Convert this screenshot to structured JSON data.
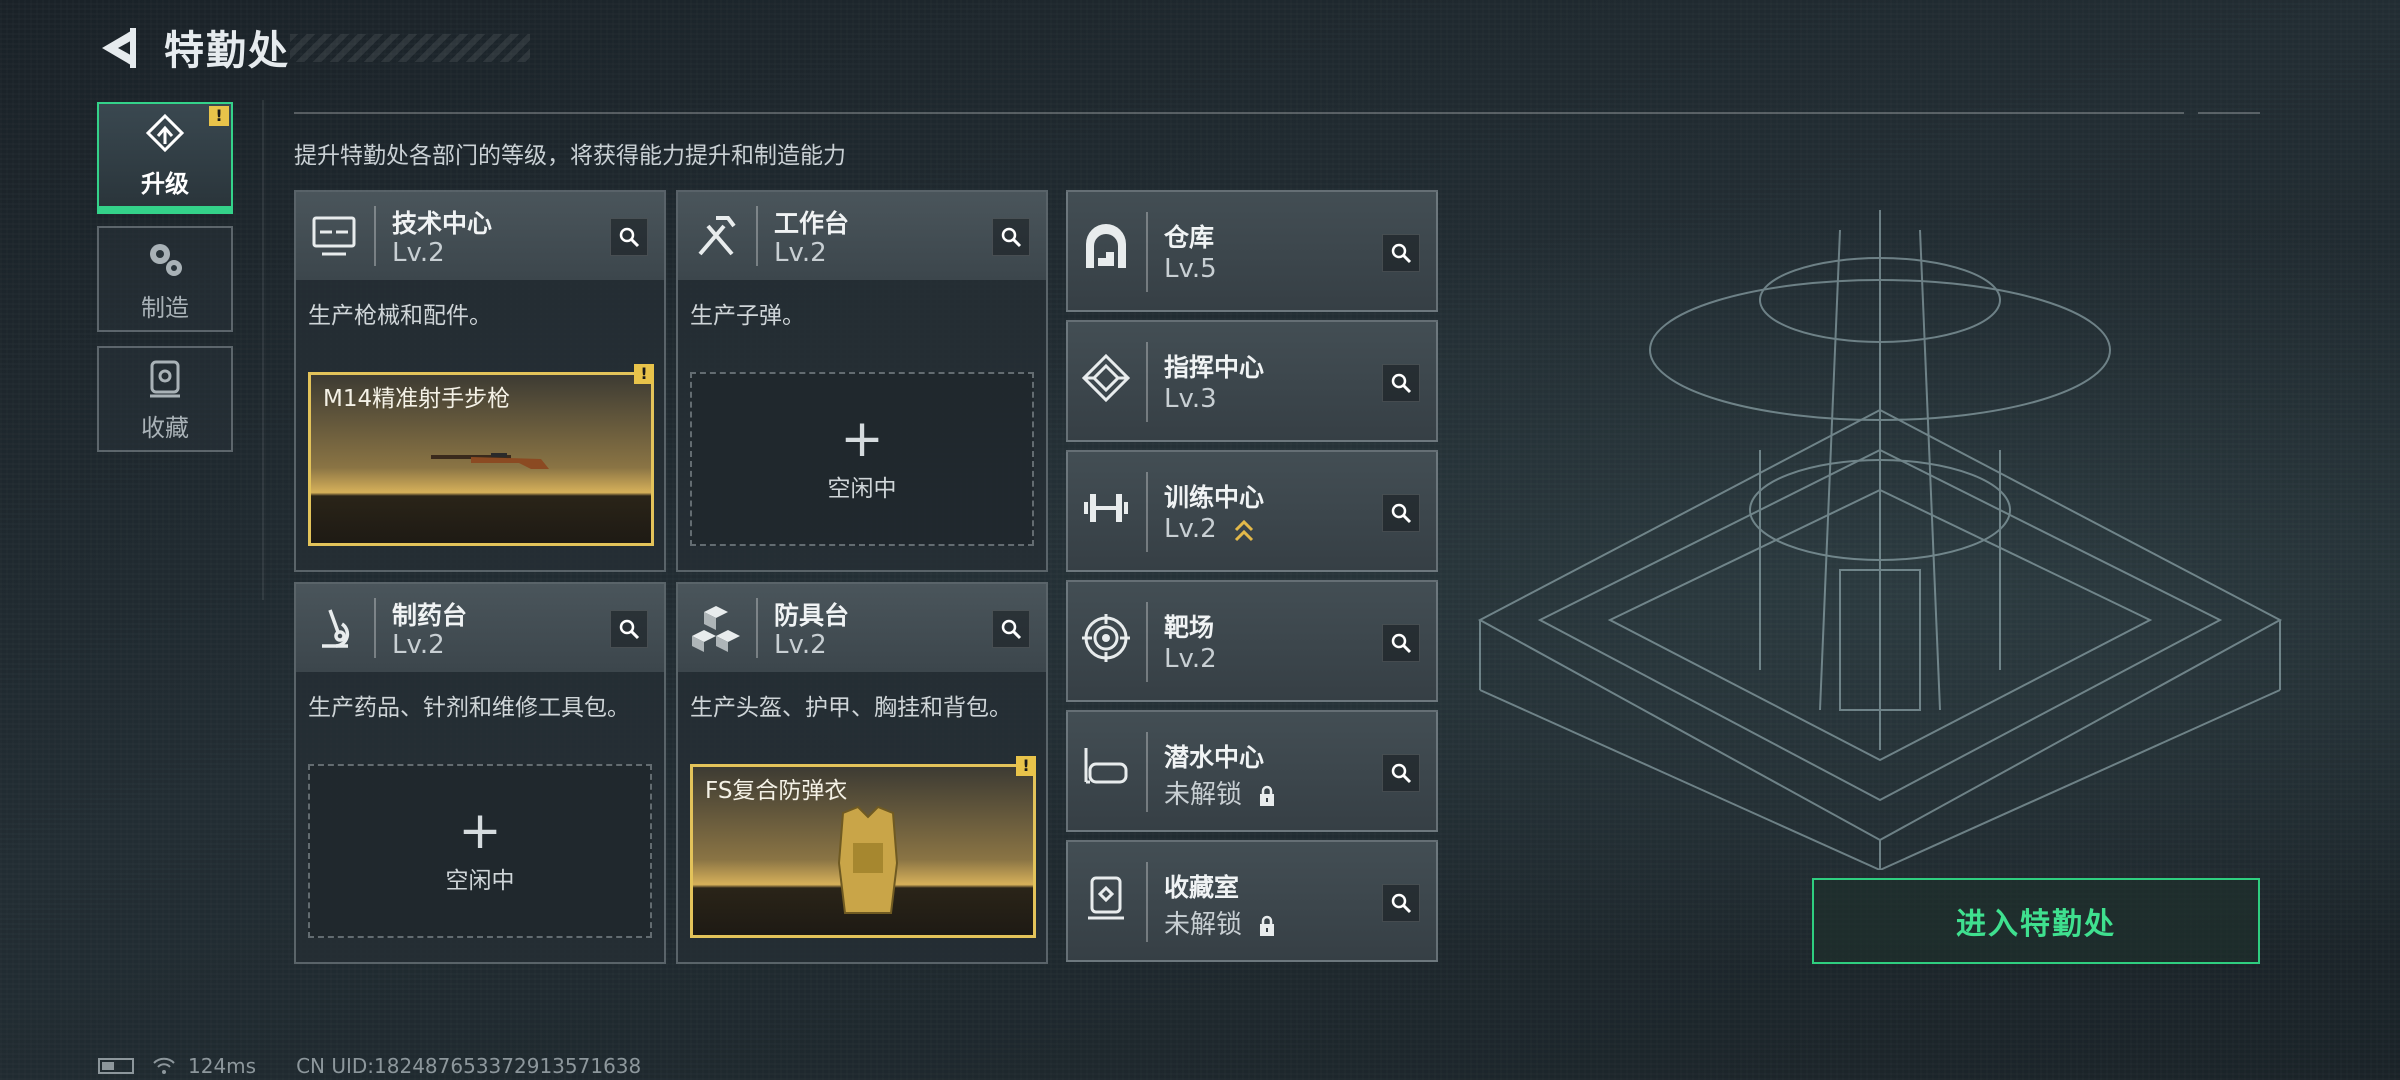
{
  "header": {
    "title": "特勤处"
  },
  "tabs": [
    {
      "label": "升级",
      "badge": "!"
    },
    {
      "label": "制造"
    },
    {
      "label": "收藏"
    }
  ],
  "main": {
    "subtitle": "提升特勤处各部门的等级，将获得能力提升和制造能力"
  },
  "departments": [
    {
      "name": "技术中心",
      "level": "Lv.2",
      "desc": "生产枪械和配件。",
      "icon": "computer-icon",
      "slot": {
        "item": "M14精准射手步枪",
        "badge": "!"
      }
    },
    {
      "name": "工作台",
      "level": "Lv.2",
      "desc": "生产子弹。",
      "icon": "hammer-wrench-icon",
      "slot": {
        "plus": "+",
        "status": "空闲中"
      }
    },
    {
      "name": "制药台",
      "level": "Lv.2",
      "desc": "生产药品、针剂和维修工具包。",
      "icon": "microscope-icon",
      "slot": {
        "plus": "+",
        "status": "空闲中"
      }
    },
    {
      "name": "防具台",
      "level": "Lv.2",
      "desc": "生产头盔、护甲、胸挂和背包。",
      "icon": "cubes-icon",
      "slot": {
        "item": "FS复合防弹衣",
        "badge": "!"
      }
    }
  ],
  "facilities": [
    {
      "name": "仓库",
      "level": "Lv.5",
      "icon": "warehouse-icon"
    },
    {
      "name": "指挥中心",
      "level": "Lv.3",
      "icon": "command-emblem-icon"
    },
    {
      "name": "训练中心",
      "level": "Lv.2",
      "icon": "dumbbell-icon",
      "upgrade_available": true
    },
    {
      "name": "靶场",
      "level": "Lv.2",
      "icon": "target-icon"
    },
    {
      "name": "潜水中心",
      "level": "未解锁",
      "icon": "diving-mask-icon",
      "locked": true
    },
    {
      "name": "收藏室",
      "level": "未解锁",
      "icon": "display-case-icon",
      "locked": true
    }
  ],
  "actions": {
    "enter_label": "进入特勤处"
  },
  "status": {
    "ping": "124ms",
    "uid": "CN UID:18248765337291357163​8"
  },
  "deco": {
    "side_code": ""
  },
  "colors": {
    "accent_green": "#34d28a",
    "highlight_gold": "#e3c35a",
    "alert_yellow": "#e8c34a"
  }
}
